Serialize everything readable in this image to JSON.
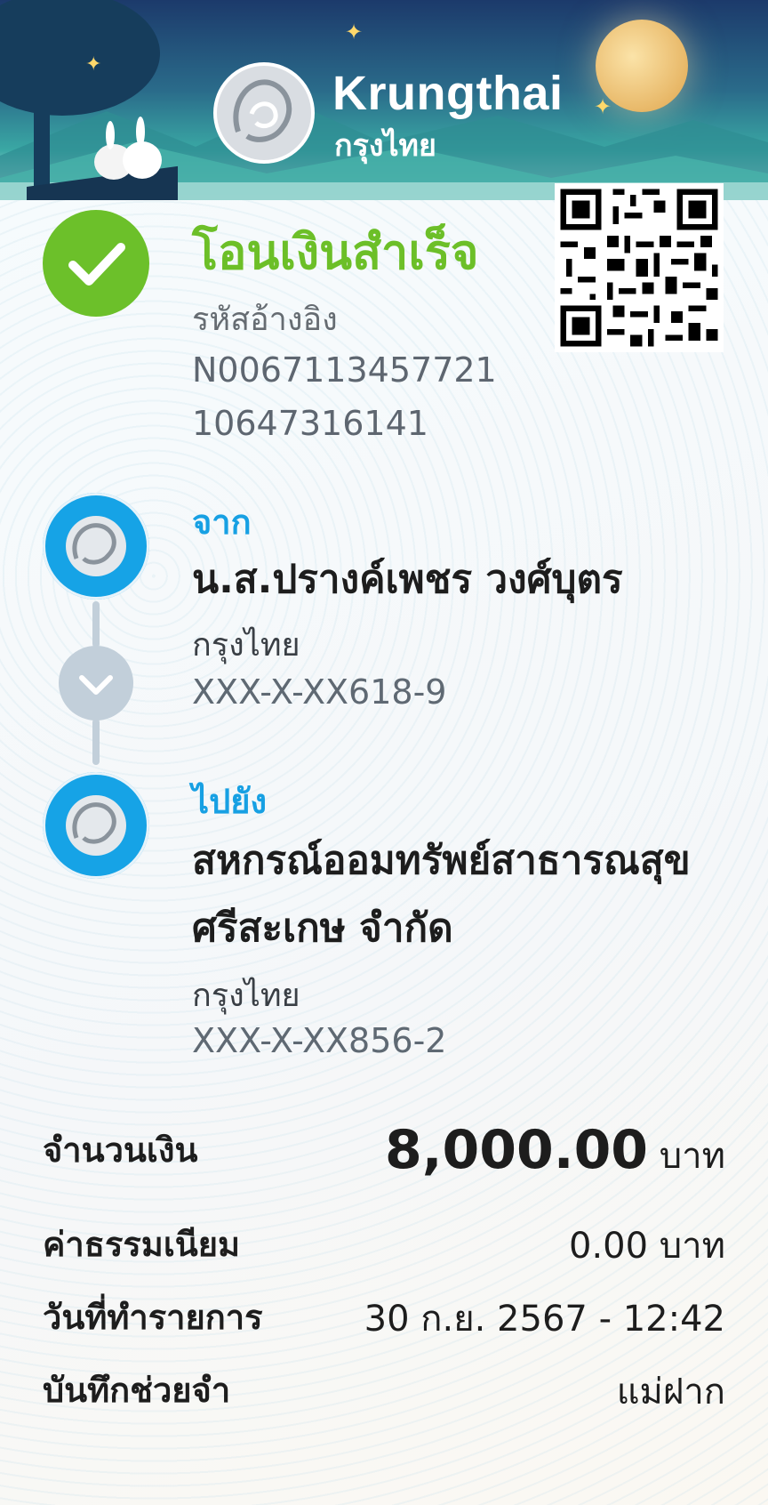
{
  "brand": {
    "name_en": "Krungthai",
    "name_th": "กรุงไทย"
  },
  "status": {
    "title": "โอนเงินสำเร็จ",
    "icon": "check-icon",
    "color": "#6cbf28"
  },
  "reference": {
    "label": "รหัสอ้างอิง",
    "value": "N006711345772110647316141"
  },
  "qr": {
    "icon": "qr-code-icon"
  },
  "from": {
    "label": "จาก",
    "name": "น.ส.ปรางค์เพชร วงศ์บุตร",
    "bank": "กรุงไทย",
    "account": "XXX-X-XX618-9"
  },
  "to": {
    "label": "ไปยัง",
    "name": "สหกรณ์ออมทรัพย์สาธารณสุขศรีสะเกษ จำกัด",
    "bank": "กรุงไทย",
    "account": "XXX-X-XX856-2"
  },
  "details": {
    "amount_label": "จำนวนเงิน",
    "amount_value": "8,000.00",
    "amount_unit": "บาท",
    "fee_label": "ค่าธรรมเนียม",
    "fee_value": "0.00 บาท",
    "date_label": "วันที่ทำรายการ",
    "date_value": "30 ก.ย. 2567 - 12:42",
    "memo_label": "บันทึกช่วยจำ",
    "memo_value": "แม่ฝาก"
  },
  "colors": {
    "accent_blue": "#17a0e3",
    "success_green": "#6cc02a",
    "connector": "#c2cfda"
  }
}
